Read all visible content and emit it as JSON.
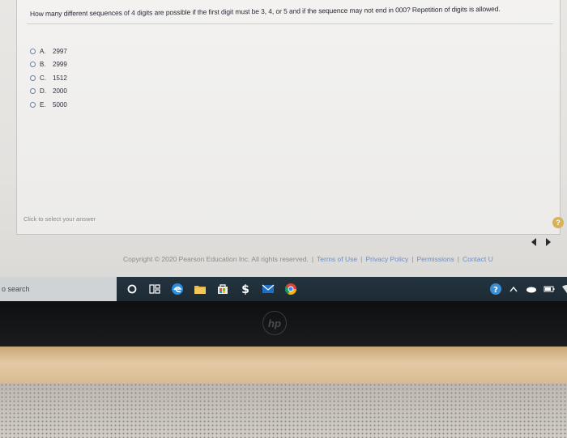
{
  "question": {
    "text": "How many different sequences of 4 digits are possible if the first digit must be 3, 4, or 5 and if the sequence may not end in 000? Repetition of digits is allowed."
  },
  "options": [
    {
      "letter": "A.",
      "value": "2997"
    },
    {
      "letter": "B.",
      "value": "2999"
    },
    {
      "letter": "C.",
      "value": "1512"
    },
    {
      "letter": "D.",
      "value": "2000"
    },
    {
      "letter": "E.",
      "value": "5000"
    }
  ],
  "hint": "Click to select your answer",
  "help_label": "?",
  "footer": {
    "copyright": "Copyright © 2020 Pearson Education Inc. All rights reserved.",
    "links": [
      "Terms of Use",
      "Privacy Policy",
      "Permissions",
      "Contact U"
    ]
  },
  "taskbar": {
    "search_placeholder": "o search"
  },
  "colors": {
    "link": "#6d8fc5",
    "taskbar": "#1f2d36",
    "radio_border": "#6a7fa8",
    "help_badge": "#d7b25a"
  }
}
